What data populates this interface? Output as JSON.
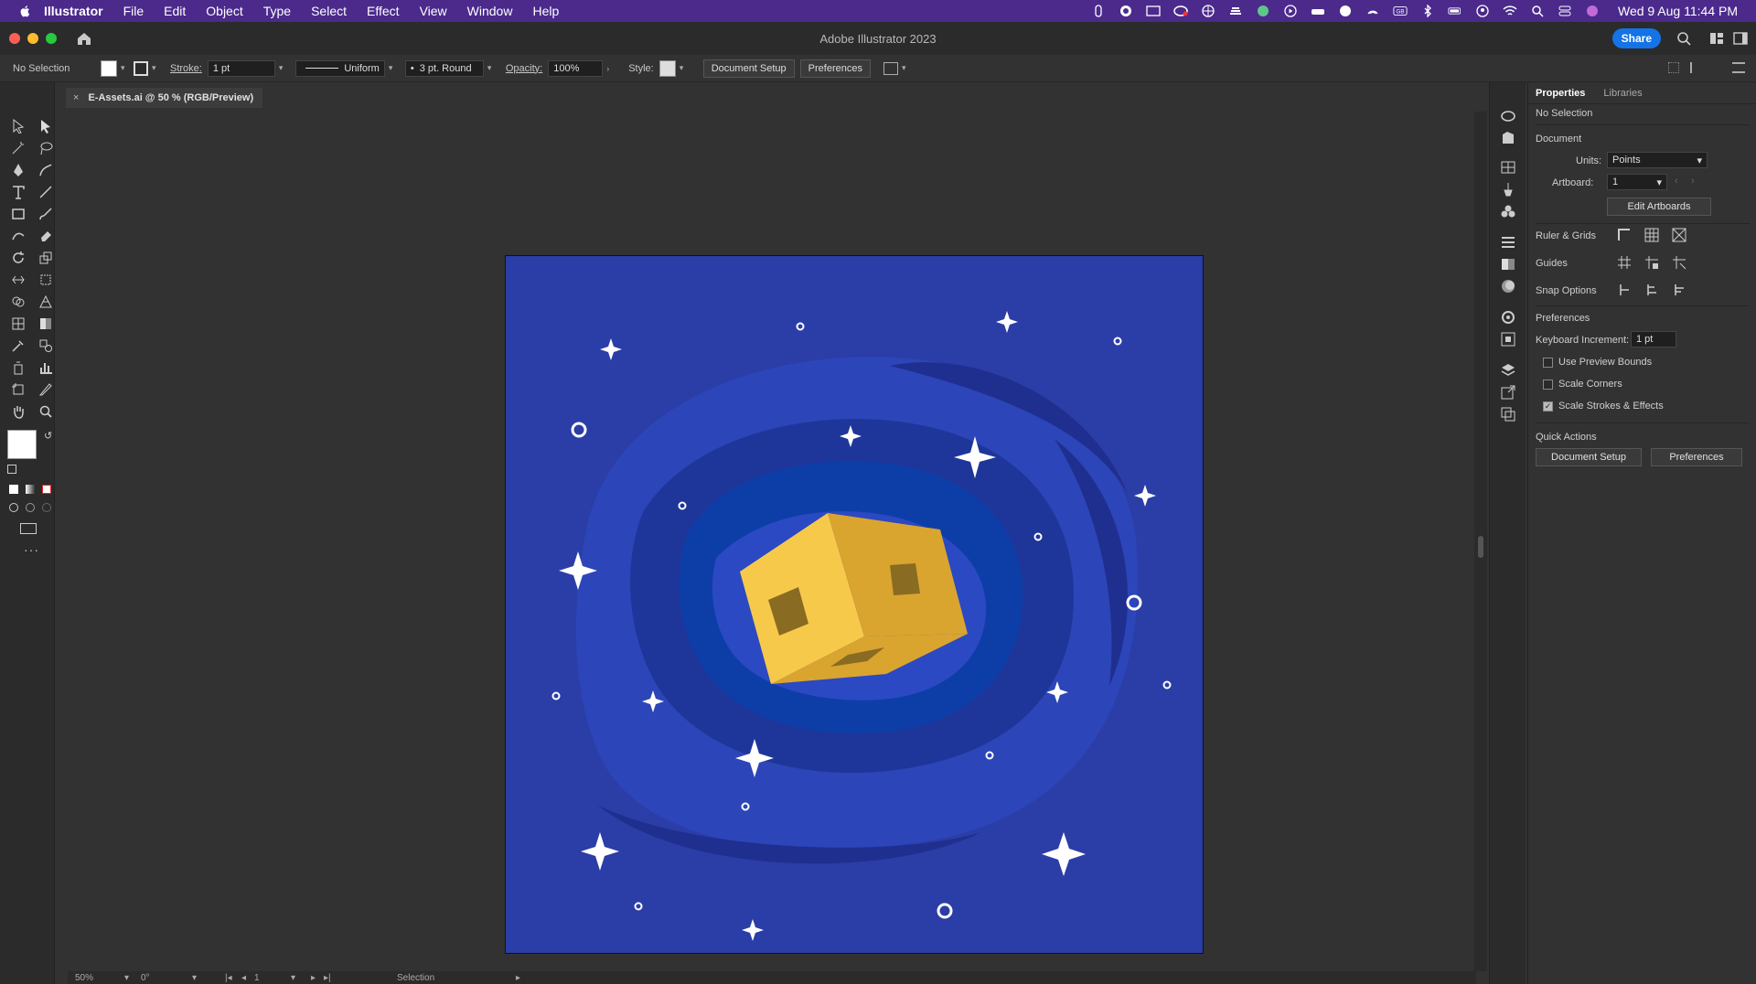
{
  "menubar": {
    "app_name": "Illustrator",
    "items": [
      "File",
      "Edit",
      "Object",
      "Type",
      "Select",
      "Effect",
      "View",
      "Window",
      "Help"
    ],
    "clock": "Wed 9 Aug  11:44 PM"
  },
  "window": {
    "title": "Adobe Illustrator 2023",
    "share_label": "Share"
  },
  "control_bar": {
    "selection_label": "No Selection",
    "stroke_label": "Stroke:",
    "stroke_value": "1 pt",
    "profile_value": "Uniform",
    "brush_value": "3 pt. Round",
    "opacity_label": "Opacity:",
    "opacity_value": "100%",
    "style_label": "Style:",
    "document_setup_label": "Document Setup",
    "preferences_label": "Preferences"
  },
  "document": {
    "tab_title": "E-Assets.ai @ 50 % (RGB/Preview)",
    "close_glyph": "×"
  },
  "status_bar": {
    "zoom": "50%",
    "rotation": "0°",
    "artboard": "1",
    "tool": "Selection"
  },
  "properties_panel": {
    "tabs": [
      "Properties",
      "Libraries"
    ],
    "selection": "No Selection",
    "document_heading": "Document",
    "units_label": "Units:",
    "units_value": "Points",
    "artboard_label": "Artboard:",
    "artboard_value": "1",
    "edit_artboards_label": "Edit Artboards",
    "ruler_grids_label": "Ruler & Grids",
    "guides_label": "Guides",
    "snap_options_label": "Snap Options",
    "preferences_heading": "Preferences",
    "keyboard_increment_label": "Keyboard Increment:",
    "keyboard_increment_value": "1 pt",
    "checkboxes": [
      {
        "label": "Use Preview Bounds",
        "checked": false
      },
      {
        "label": "Scale Corners",
        "checked": false
      },
      {
        "label": "Scale Strokes & Effects",
        "checked": true
      }
    ],
    "quick_actions_heading": "Quick Actions",
    "quick_document_setup": "Document Setup",
    "quick_preferences": "Preferences"
  },
  "colors": {
    "menubar_bg": "#4b2a8c",
    "artboard_bg": "#2b3da6",
    "cube_light": "#f7c94b",
    "cube_dark": "#d9a52f",
    "accent": "#1473e6"
  }
}
